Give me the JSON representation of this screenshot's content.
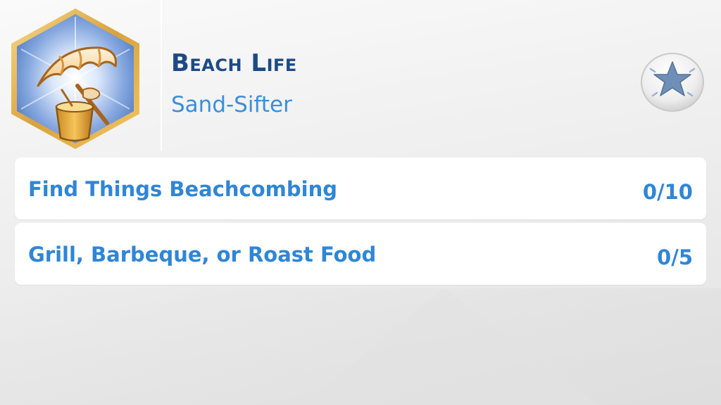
{
  "aspiration": {
    "icon": "beach-umbrella-icon",
    "title": "Beach Life",
    "milestone": "Sand-Sifter"
  },
  "action_button": {
    "icon": "star-icon"
  },
  "goals": [
    {
      "label": "Find Things Beachcombing",
      "progress": "0/10",
      "current": 0,
      "total": 10
    },
    {
      "label": "Grill, Barbeque, or Roast Food",
      "progress": "0/5",
      "current": 0,
      "total": 5
    }
  ],
  "colors": {
    "title": "#1d4a86",
    "accent": "#2f86d6",
    "badge_frame": "#e6b54a",
    "badge_fill": "#5e87c9"
  }
}
